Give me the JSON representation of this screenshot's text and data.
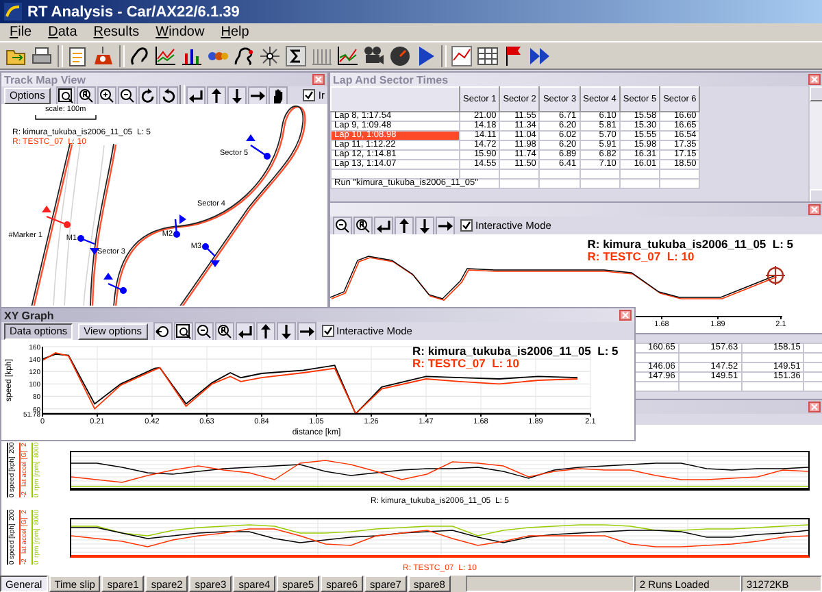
{
  "window": {
    "title": "RT Analysis - Car/AX22/6.1.39"
  },
  "menu": [
    "File",
    "Data",
    "Results",
    "Window",
    "Help"
  ],
  "track_map": {
    "title": "Track Map View",
    "active": false,
    "options_button": "Options",
    "interactive_mode": {
      "label": "Ir",
      "checked": true
    },
    "scale": "scale: 100m",
    "legend": [
      {
        "text": "R: kimura_tukuba_is2006_11_05  L: 5",
        "color": "#000000"
      },
      {
        "text": "R: TESTC_07  L: 10",
        "color": "#ff3300"
      }
    ],
    "markers": [
      {
        "label": "#Marker 1",
        "color": "#ff2020"
      },
      {
        "label": "M1",
        "color": "#0000ff"
      },
      {
        "label": "M2",
        "color": "#0000ff"
      },
      {
        "label": "M3",
        "color": "#0000ff"
      },
      {
        "color": "#0000ff"
      },
      {
        "color": "#0000ff"
      }
    ],
    "sector_labels": [
      "Sector 3",
      "Sector 4",
      "Sector 5"
    ]
  },
  "lap_table": {
    "title": "Lap And Sector Times",
    "active": false,
    "columns": [
      "Sector 1",
      "Sector 2",
      "Sector 3",
      "Sector 4",
      "Sector 5",
      "Sector 6"
    ],
    "rows": [
      {
        "lap": "Lap 8, 1:17.54",
        "values": [
          "21.00",
          "11.55",
          "6.71",
          "6.10",
          "15.58",
          "16.60"
        ],
        "selected": false
      },
      {
        "lap": "Lap 9, 1:09.48",
        "values": [
          "14.18",
          "11.34",
          "6.20",
          "5.81",
          "15.30",
          "16.65"
        ],
        "selected": false
      },
      {
        "lap": "Lap 10, 1:08.98",
        "values": [
          "14.11",
          "11.04",
          "6.02",
          "5.70",
          "15.55",
          "16.54"
        ],
        "selected": true
      },
      {
        "lap": "Lap 11, 1:12.22",
        "values": [
          "14.72",
          "11.98",
          "6.20",
          "5.91",
          "15.98",
          "17.35"
        ],
        "selected": false
      },
      {
        "lap": "Lap 12, 1:14.81",
        "values": [
          "15.90",
          "11.74",
          "6.89",
          "6.82",
          "16.31",
          "17.15"
        ],
        "selected": false
      },
      {
        "lap": "Lap 13, 1:14.07",
        "values": [
          "14.55",
          "11.50",
          "6.41",
          "7.10",
          "16.01",
          "18.50"
        ],
        "selected": false
      }
    ],
    "run_row": "Run \"kimura_tukuba_is2006_11_05\""
  },
  "graph_window": {
    "active": false,
    "interactive_mode": {
      "label": "Interactive Mode",
      "checked": true
    },
    "legend": [
      {
        "text": "R: kimura_tukuba_is2006_11_05  L: 5",
        "color": "#000000"
      },
      {
        "text": "R: TESTC_07  L: 10",
        "color": "#ff3300"
      }
    ],
    "x_tick_labels": [
      "1.68",
      "1.89",
      "2.1"
    ]
  },
  "table_window": {
    "rows": [
      {
        "kind": "values",
        "cells": [
          "160.65",
          "157.63",
          "158.15"
        ]
      },
      {
        "kind": "blank"
      },
      {
        "kind": "values",
        "cells": [
          "146.06",
          "147.52",
          "149.51"
        ]
      },
      {
        "kind": "values",
        "cells": [
          "147.96",
          "149.51",
          "151.36"
        ]
      },
      {
        "kind": "blank"
      }
    ]
  },
  "xy_graph": {
    "title": "XY Graph",
    "active": true,
    "buttons": [
      {
        "label": "Data options",
        "pressed": true
      },
      {
        "label": "View options",
        "pressed": false
      }
    ],
    "interactive_mode": {
      "label": "Interactive Mode",
      "checked": true
    },
    "chart_data": {
      "type": "line",
      "xlabel": "distance [km]",
      "ylabel": "speed [kph]",
      "x": [
        0,
        0.05,
        0.1,
        0.2,
        0.3,
        0.43,
        0.45,
        0.55,
        0.65,
        0.72,
        0.76,
        0.84,
        1.0,
        1.12,
        1.2,
        1.3,
        1.47,
        1.6,
        1.75,
        1.9,
        2.05
      ],
      "series": [
        {
          "name": "R: kimura_tukuba_is2006_11_05  L: 5",
          "color": "#000000",
          "values": [
            140,
            148,
            146,
            68,
            100,
            125,
            126,
            68,
            102,
            118,
            110,
            117,
            122,
            130,
            52,
            95,
            112,
            110,
            108,
            112,
            110
          ]
        },
        {
          "name": "R: TESTC_07  L: 10",
          "color": "#ff3300",
          "values": [
            138,
            150,
            145,
            60,
            98,
            123,
            126,
            64,
            100,
            112,
            104,
            110,
            118,
            125,
            52,
            92,
            108,
            104,
            100,
            106,
            108
          ]
        }
      ],
      "grid": true,
      "xlim": [
        0,
        2.1
      ],
      "ylim": [
        51.78,
        160
      ],
      "xticks": [
        0,
        0.21,
        0.42,
        0.63,
        0.84,
        1.05,
        1.26,
        1.47,
        1.68,
        1.89,
        2.1
      ],
      "yticks": [
        51.78,
        60,
        80,
        100,
        120,
        140,
        160
      ]
    }
  },
  "strip_charts": {
    "active": false,
    "charts": [
      {
        "caption": "R: kimura_tukuba_is2006_11_05  L: 5",
        "color": "#000000",
        "axes": [
          {
            "label": "speed [kph]",
            "min": "0",
            "max": "200",
            "color": "#000000"
          },
          {
            "label": "lat accel [G]",
            "min": "-2",
            "max": "2",
            "color": "#ff3300"
          },
          {
            "label": "rpm [rpm]",
            "min": "0",
            "max": "8000",
            "color": "#99cc00"
          }
        ]
      },
      {
        "caption": "R: TESTC_07  L: 10",
        "color": "#ff3300",
        "axes": [
          {
            "label": "speed [kph]",
            "min": "0",
            "max": "200",
            "color": "#000000"
          },
          {
            "label": "lat accel [G]",
            "min": "-2",
            "max": "2",
            "color": "#ff3300"
          },
          {
            "label": "rpm [rpm]",
            "min": "0",
            "max": "8000",
            "color": "#99cc00"
          }
        ]
      }
    ]
  },
  "status_bar": {
    "tabs": [
      {
        "label": "General",
        "selected": true
      },
      {
        "label": "Time slip",
        "selected": false
      },
      {
        "label": "spare1",
        "selected": false
      },
      {
        "label": "spare2",
        "selected": false
      },
      {
        "label": "spare3",
        "selected": false
      },
      {
        "label": "spare4",
        "selected": false
      },
      {
        "label": "spare5",
        "selected": false
      },
      {
        "label": "spare6",
        "selected": false
      },
      {
        "label": "spare7",
        "selected": false
      },
      {
        "label": "spare8",
        "selected": false
      }
    ],
    "panels": [
      "2 Runs Loaded",
      "31272KB"
    ]
  }
}
